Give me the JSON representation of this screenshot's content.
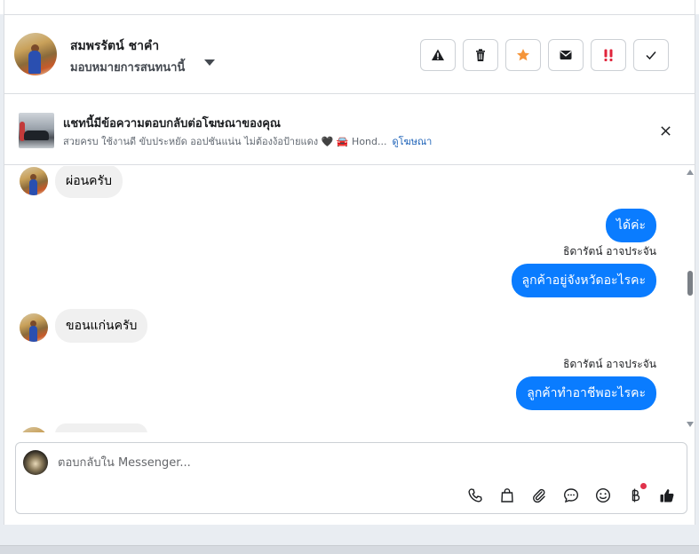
{
  "contact": {
    "name": "สมพรรัตน์ ชาคำ",
    "assign_label": "มอบหมายการสนทนานี้"
  },
  "header_actions": [
    {
      "name": "warning",
      "color": "#1c1e21"
    },
    {
      "name": "trash",
      "color": "#1c1e21"
    },
    {
      "name": "star",
      "color": "#f5953a"
    },
    {
      "name": "envelope",
      "color": "#1c1e21"
    },
    {
      "name": "priority",
      "color": "#e0243b"
    },
    {
      "name": "check",
      "color": "#1c1e21"
    }
  ],
  "ad_banner": {
    "title": "แชทนี้มีข้อความตอบกลับต่อโฆษณาของคุณ",
    "text": "สวยครบ ใช้งานดี ขับประหยัด ออปชันแน่น ไม่ต้องง้อป้ายแดง 🖤 🚘 Hond...",
    "link": "ดูโฆษณา"
  },
  "messages": [
    {
      "direction": "in",
      "text": "ผ่อนครับ"
    },
    {
      "direction": "out",
      "text": "ได้ค่ะ"
    },
    {
      "direction": "out",
      "sender": "ธิดารัตน์ อาจประจัน",
      "text": "ลูกค้าอยู่จังหวัดอะไรคะ"
    },
    {
      "direction": "in",
      "text": "ขอนแก่นครับ"
    },
    {
      "direction": "out",
      "sender": "ธิดารัตน์ อาจประจัน",
      "text": "ลูกค้าทำอาชีพอะไรคะ"
    }
  ],
  "composer": {
    "placeholder": "ตอบกลับใน Messenger...",
    "tools": [
      "phone-icon",
      "shopping-bag-icon",
      "paperclip-icon",
      "saved-reply-icon",
      "emoji-icon",
      "baht-payment-icon",
      "thumbs-up-icon"
    ]
  },
  "colors": {
    "outgoing_bubble": "#0a7cff",
    "incoming_bubble": "#f0f0f0",
    "link": "#1d62b8"
  }
}
